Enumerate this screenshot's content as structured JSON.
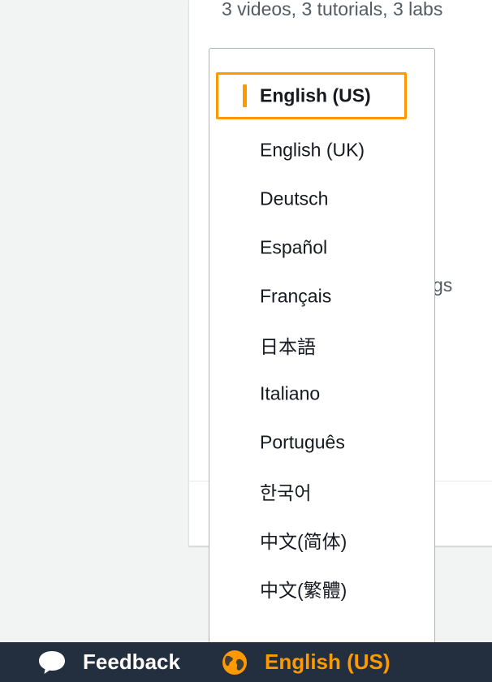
{
  "background_card": {
    "subtitle": "3 videos, 3 tutorials, 3 labs",
    "partial_text": "gs"
  },
  "language_menu": {
    "selected_index": 0,
    "items": [
      {
        "label": "English (US)"
      },
      {
        "label": "English (UK)"
      },
      {
        "label": "Deutsch"
      },
      {
        "label": "Español"
      },
      {
        "label": "Français"
      },
      {
        "label": "日本語"
      },
      {
        "label": "Italiano"
      },
      {
        "label": "Português"
      },
      {
        "label": "한국어"
      },
      {
        "label": "中文(简体)"
      },
      {
        "label": "中文(繁體)"
      }
    ]
  },
  "footer": {
    "feedback_label": "Feedback",
    "feedback_icon": "speech-bubble-icon",
    "language_label": "English (US)",
    "language_icon": "globe-icon"
  },
  "colors": {
    "accent": "#ff9900",
    "footer_bg": "#232f3e",
    "text": "#16191f",
    "muted_text": "#545b64"
  }
}
